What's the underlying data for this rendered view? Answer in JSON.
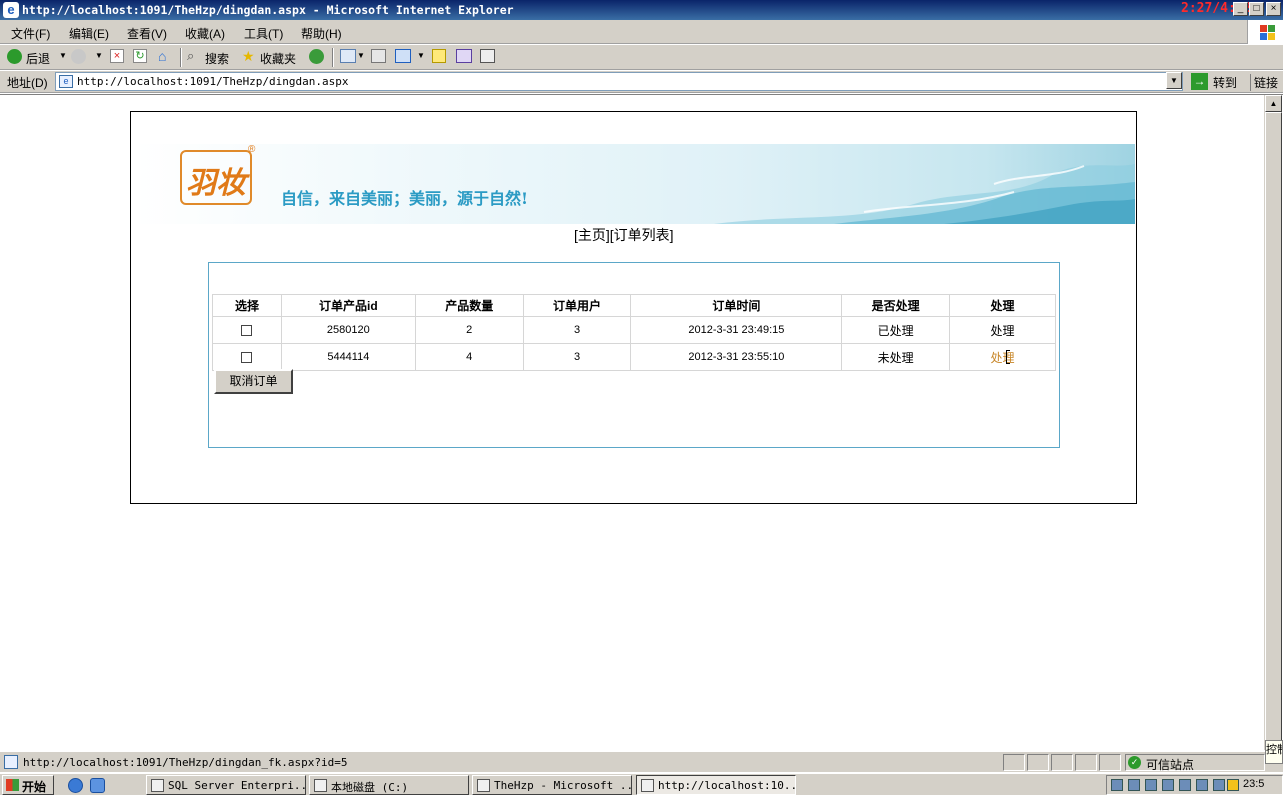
{
  "window": {
    "title": "http://localhost:1091/TheHzp/dingdan.aspx - Microsoft Internet Explorer",
    "clock_overlay": "2:27/4:52",
    "buttons": [
      "_",
      "□",
      "×"
    ]
  },
  "menu": [
    "文件(F)",
    "编辑(E)",
    "查看(V)",
    "收藏(A)",
    "工具(T)",
    "帮助(H)"
  ],
  "toolbar": {
    "back_label": "后退",
    "search_label": "搜索",
    "favorites_label": "收藏夹"
  },
  "address": {
    "label": "地址(D)",
    "url": "http://localhost:1091/TheHzp/dingdan.aspx",
    "go_label": "转到",
    "links_label": "链接"
  },
  "page": {
    "logo_text": "羽妆",
    "logo_reg": "®",
    "slogan": "自信，来自美丽；美丽，源于自然!",
    "nav": {
      "home": "[主页]",
      "orders": "[订单列表]"
    },
    "table": {
      "headers": [
        "选择",
        "订单产品id",
        "产品数量",
        "订单用户",
        "订单时间",
        "是否处理",
        "处理"
      ],
      "rows": [
        {
          "product_id": "2580120",
          "qty": "2",
          "user": "3",
          "time": "2012-3-31 23:49:15",
          "status": "已处理",
          "action": "处理"
        },
        {
          "product_id": "5444114",
          "qty": "4",
          "user": "3",
          "time": "2012-3-31 23:55:10",
          "status": "未处理",
          "action": "处理"
        }
      ]
    },
    "cancel_button": "取消订单"
  },
  "status": {
    "text": "http://localhost:1091/TheHzp/dingdan_fk.aspx?id=5",
    "zone": "可信站点"
  },
  "taskbar": {
    "start": "开始",
    "tasks": [
      "SQL Server Enterpri...",
      "本地磁盘 (C:)",
      "TheHzp - Microsoft ...",
      "http://localhost:10..."
    ],
    "clock": "23:5",
    "popup": "控制"
  },
  "colors": {
    "titlebar": "#0a246a",
    "slogan": "#2b9bc4",
    "logo": "#e07a18",
    "panel_border": "#5ba7c8",
    "unprocessed_link": "#c8872a"
  }
}
